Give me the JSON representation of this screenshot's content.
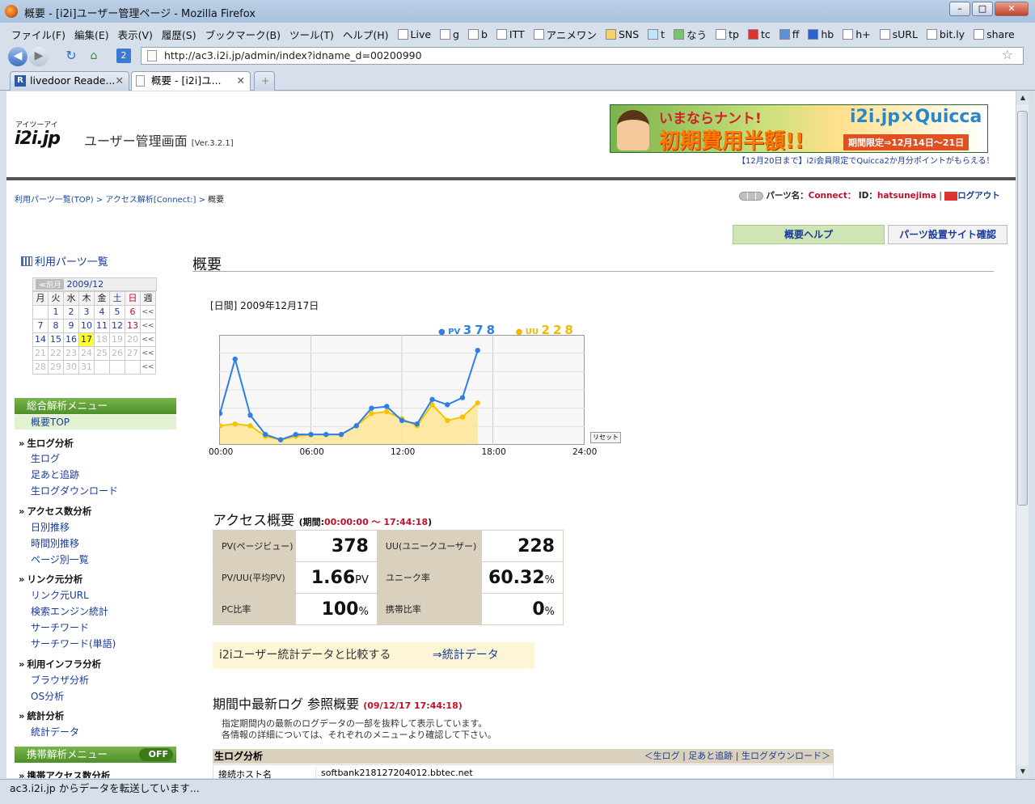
{
  "window": {
    "title": "概要 - [i2i]ユーザー管理ページ - Mozilla Firefox"
  },
  "menubar": {
    "items": [
      "ファイル(F)",
      "編集(E)",
      "表示(V)",
      "履歴(S)",
      "ブックマーク(B)",
      "ツール(T)",
      "ヘルプ(H)"
    ],
    "bookmarks": [
      "Live",
      "g",
      "b",
      "ITT",
      "アニメワン",
      "SNS",
      "t",
      "なう",
      "tp",
      "tc",
      "ff",
      "hb",
      "h+",
      "sURL",
      "bit.ly",
      "share"
    ]
  },
  "nav": {
    "url": "http://ac3.i2i.jp/admin/index?idname_d=00200990"
  },
  "tabs": [
    {
      "label": "livedoor Reade...",
      "active": false
    },
    {
      "label": "概要 - [i2i]ユ...",
      "active": true
    }
  ],
  "header": {
    "logo_ruby": "アイツーアイ",
    "logo": "i2i.jp",
    "app_title": "ユーザー管理画面",
    "version": "[Ver.3.2.1]",
    "banner": {
      "line1": "いまならナント!",
      "line2": "初期費用半額!!",
      "brand": "i2i.jp×Quicca",
      "period": "期間限定⇒12月14日～21日"
    },
    "banner_note": "【12月20日まで】i2i会員限定でQuicca2か月分ポイントがもらえる！"
  },
  "breadcrumb": {
    "items": [
      "利用パーツ一覧(TOP)",
      "アクセス解析[Connect:]"
    ],
    "current": "概要"
  },
  "parts": {
    "label": "パーツ名：",
    "name": "Connect：",
    "id_label": "ID：",
    "id": "hatsunejima",
    "logout": "ログアウト"
  },
  "buttons": {
    "help": "概要ヘルプ",
    "site_check": "パーツ設置サイト確認"
  },
  "sidebar": {
    "parts_list": "利用パーツ一覧",
    "calendar": {
      "prev": "≪前月",
      "month": "2009/12",
      "headers": [
        "月",
        "火",
        "水",
        "木",
        "金",
        "土",
        "日",
        "週"
      ],
      "rows": [
        [
          "",
          "1",
          "2",
          "3",
          "4",
          "5",
          "6",
          "<<"
        ],
        [
          "7",
          "8",
          "9",
          "10",
          "11",
          "12",
          "13",
          "<<"
        ],
        [
          "14",
          "15",
          "16",
          "17",
          "18",
          "19",
          "20",
          "<<"
        ],
        [
          "21",
          "22",
          "23",
          "24",
          "25",
          "26",
          "27",
          "<<"
        ],
        [
          "28",
          "29",
          "30",
          "31",
          "",
          "",
          "",
          "<<"
        ]
      ],
      "today": "17"
    },
    "menu_title": "総合解析メニュー",
    "selected": "概要TOP",
    "sections": [
      {
        "title": "生ログ分析",
        "links": [
          "生ログ",
          "足あと追跡",
          "生ログダウンロード"
        ]
      },
      {
        "title": "アクセス数分析",
        "links": [
          "日別推移",
          "時間別推移",
          "ページ別一覧"
        ]
      },
      {
        "title": "リンク元分析",
        "links": [
          "リンク元URL",
          "検索エンジン統計",
          "サーチワード",
          "サーチワード(単語)"
        ]
      },
      {
        "title": "利用インフラ分析",
        "links": [
          "ブラウザ分析",
          "OS分析"
        ]
      },
      {
        "title": "統計分析",
        "links": [
          "統計データ"
        ]
      }
    ],
    "mobile_menu": "携帯解析メニュー",
    "mobile_toggle": "OFF",
    "mobile_section": "携帯アクセス数分析"
  },
  "main": {
    "title": "概要",
    "date_label": "[日間] 2009年12月17日",
    "legend": {
      "pv_label": "PV",
      "pv_value": "378",
      "uu_label": "UU",
      "uu_value": "228"
    },
    "reset": "リセット",
    "access_title": "アクセス概要",
    "period_label": "(期間:",
    "period_value": "00:00:00 ～ 17:44:18",
    "period_close": ")",
    "stats": {
      "pv_label": "PV(ページビュー)",
      "pv": "378",
      "uu_label": "UU(ユニークユーザー)",
      "uu": "228",
      "pvuu_label": "PV/UU(平均PV)",
      "pvuu": "1.66",
      "pvuu_unit": "PV",
      "unique_label": "ユニーク率",
      "unique": "60.32",
      "unique_unit": "%",
      "pc_label": "PC比率",
      "pc": "100",
      "pc_unit": "%",
      "mobile_label": "携帯比率",
      "mobile": "0",
      "mobile_unit": "%"
    },
    "compare_text": "i2iユーザー統計データと比較する",
    "compare_link": "⇒統計データ",
    "log_title": "期間中最新ログ 参照概要",
    "log_time": "(09/12/17 17:44:18)",
    "note_line1": "指定期間内の最新のログデータの一部を抜粋して表示しています。",
    "note_line2": "各情報の詳細については、それぞれのメニューより確認して下さい。",
    "log_section": "生ログ分析",
    "log_links": "＜生ログ | 足あと追跡 | 生ログダウンロード＞",
    "log_host_label": "接続ホスト名",
    "log_host": "softbank218127204012.bbtec.net"
  },
  "status": {
    "text": "ac3.i2i.jp からデータを転送しています..."
  },
  "chart_data": {
    "type": "area",
    "x": [
      "00:00",
      "01:00",
      "02:00",
      "03:00",
      "04:00",
      "05:00",
      "06:00",
      "07:00",
      "08:00",
      "09:00",
      "10:00",
      "11:00",
      "12:00",
      "13:00",
      "14:00",
      "15:00",
      "16:00",
      "17:00"
    ],
    "x_ticks": [
      "00:00",
      "06:00",
      "12:00",
      "18:00",
      "24:00"
    ],
    "xlim": [
      "00:00",
      "24:00"
    ],
    "ylim": [
      0,
      60
    ],
    "series": [
      {
        "name": "PV",
        "color": "#2f7ee6",
        "values": [
          17,
          48,
          16,
          5,
          2,
          5,
          5,
          5,
          5,
          10,
          20,
          21,
          13,
          11,
          25,
          22,
          26,
          53
        ]
      },
      {
        "name": "UU",
        "color": "#f5c400",
        "values": [
          10,
          11,
          10,
          4,
          2,
          4,
          5,
          5,
          5,
          10,
          17,
          18,
          14,
          10,
          22,
          13,
          15,
          23
        ]
      }
    ],
    "grid": true
  }
}
